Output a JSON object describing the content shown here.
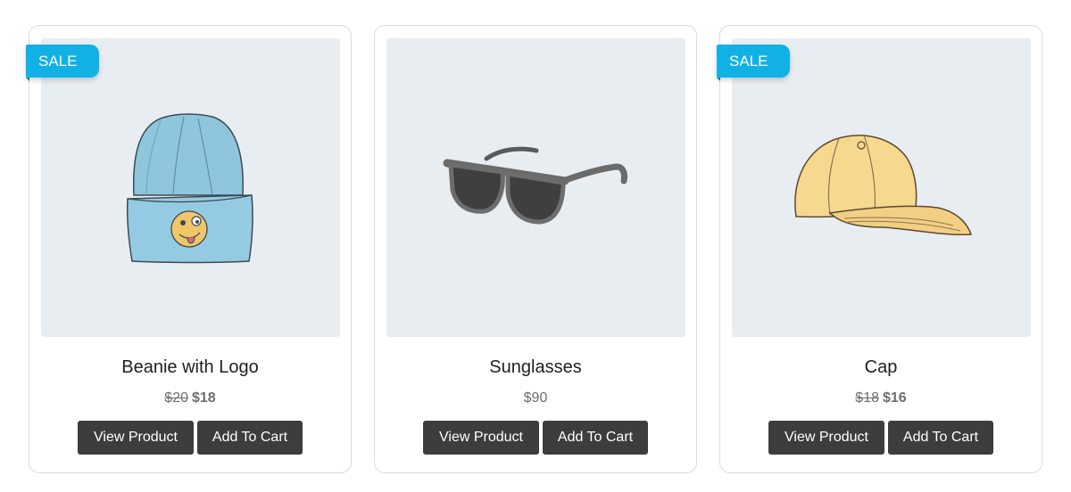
{
  "products": [
    {
      "title": "Beanie with Logo",
      "badge": "SALE",
      "price_old": "$20",
      "price": "$18",
      "view_label": "View Product",
      "cart_label": "Add To Cart",
      "image": "beanie-image"
    },
    {
      "title": "Sunglasses",
      "badge": "",
      "price_old": "",
      "price": "$90",
      "view_label": "View Product",
      "cart_label": "Add To Cart",
      "image": "sunglasses-image"
    },
    {
      "title": "Cap",
      "badge": "SALE",
      "price_old": "$18",
      "price": "$16",
      "view_label": "View Product",
      "cart_label": "Add To Cart",
      "image": "cap-image"
    }
  ],
  "colors": {
    "badge": "#11b1e6",
    "button": "#3d3d3d",
    "image_bg": "#e8edf2"
  }
}
